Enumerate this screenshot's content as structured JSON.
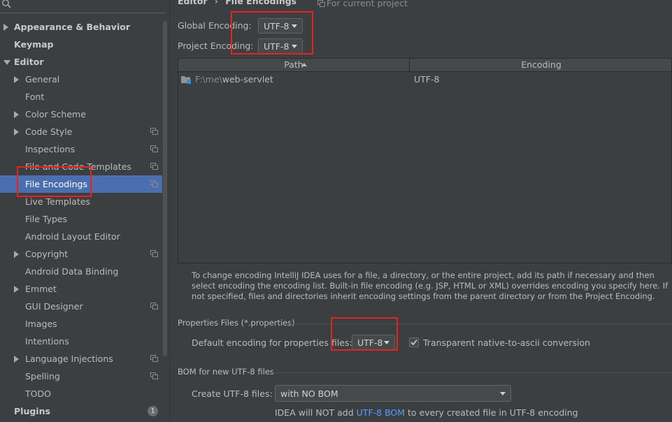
{
  "sidebar": {
    "items": [
      {
        "label": "Appearance & Behavior",
        "level": 0,
        "arrow": "closed"
      },
      {
        "label": "Keymap",
        "level": 0
      },
      {
        "label": "Editor",
        "level": 0,
        "arrow": "open"
      },
      {
        "label": "General",
        "level": 1,
        "arrow": "closed"
      },
      {
        "label": "Font",
        "level": 1
      },
      {
        "label": "Color Scheme",
        "level": 1,
        "arrow": "closed"
      },
      {
        "label": "Code Style",
        "level": 1,
        "arrow": "closed",
        "project": true
      },
      {
        "label": "Inspections",
        "level": 1,
        "project": true
      },
      {
        "label": "File and Code Templates",
        "level": 1,
        "project": true
      },
      {
        "label": "File Encodings",
        "level": 1,
        "project": true,
        "selected": true
      },
      {
        "label": "Live Templates",
        "level": 1
      },
      {
        "label": "File Types",
        "level": 1
      },
      {
        "label": "Android Layout Editor",
        "level": 1
      },
      {
        "label": "Copyright",
        "level": 1,
        "arrow": "closed",
        "project": true
      },
      {
        "label": "Android Data Binding",
        "level": 1
      },
      {
        "label": "Emmet",
        "level": 1,
        "arrow": "closed"
      },
      {
        "label": "GUI Designer",
        "level": 1,
        "project": true
      },
      {
        "label": "Images",
        "level": 1
      },
      {
        "label": "Intentions",
        "level": 1
      },
      {
        "label": "Language Injections",
        "level": 1,
        "arrow": "closed",
        "project": true
      },
      {
        "label": "Spelling",
        "level": 1,
        "project": true
      },
      {
        "label": "TODO",
        "level": 1
      },
      {
        "label": "Plugins",
        "level": 0,
        "badge": "1"
      }
    ]
  },
  "breadcrumb": {
    "parent": "Editor",
    "separator": "›",
    "current": "File Encodings",
    "note": "For current project"
  },
  "global_encoding": {
    "label": "Global Encoding:",
    "value": "UTF-8"
  },
  "project_encoding": {
    "label": "Project Encoding:",
    "value": "UTF-8"
  },
  "table": {
    "columns": [
      "Path",
      "Encoding"
    ],
    "rows": [
      {
        "path_prefix": "F:\\me\\",
        "path_name": "web-servlet",
        "encoding": "UTF-8"
      }
    ]
  },
  "help_text": "To change encoding IntelliJ IDEA uses for a file, a directory, or the entire project, add its path if necessary and then select encoding the encoding list. Built-in file encoding (e.g. JSP, HTML or XML) overrides encoding you specify here. If not specified, files and directories inherit encoding settings from the parent directory or from the Project Encoding.",
  "properties": {
    "title": "Properties Files (*.properties)",
    "default_label": "Default encoding for properties files:",
    "default_value": "UTF-8",
    "native_label": "Transparent native-to-ascii conversion",
    "native_checked": true
  },
  "bom": {
    "title": "BOM for new UTF-8 files",
    "create_label": "Create UTF-8 files:",
    "create_value": "with NO BOM",
    "note_prefix": "IDEA will NOT add ",
    "note_link": "UTF-8 BOM",
    "note_suffix": " to every created file in UTF-8 encoding"
  },
  "colors": {
    "accent_selected": "#4b6eaf",
    "highlight": "#e8231f",
    "link": "#589df6",
    "background": "#3c3f41"
  }
}
